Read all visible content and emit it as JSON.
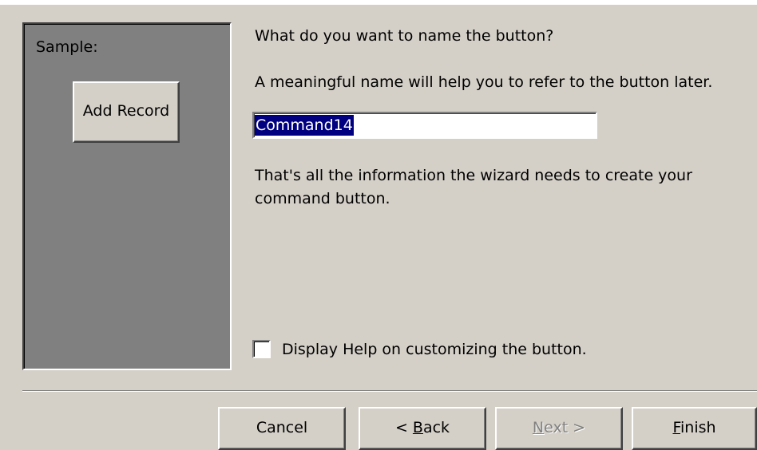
{
  "sample": {
    "label": "Sample:",
    "button_label": "Add Record"
  },
  "prompt": {
    "question": "What do you want to name the button?",
    "hint": "A meaningful name will help you to refer to the button later."
  },
  "name_field": {
    "value": "Command14"
  },
  "info": {
    "line1": "That's all the information the wizard needs to create your",
    "line2": "command button."
  },
  "help_checkbox": {
    "label": "Display Help on customizing the button.",
    "checked": false
  },
  "buttons": {
    "cancel": "Cancel",
    "back_prefix": "< ",
    "back_accel": "B",
    "back_rest": "ack",
    "next_accel": "N",
    "next_rest": "ext >",
    "finish_accel": "F",
    "finish_rest": "inish"
  },
  "colors": {
    "dialog_bg": "#d4d0c8",
    "sample_bg": "#808080",
    "selection_bg": "#000080"
  }
}
